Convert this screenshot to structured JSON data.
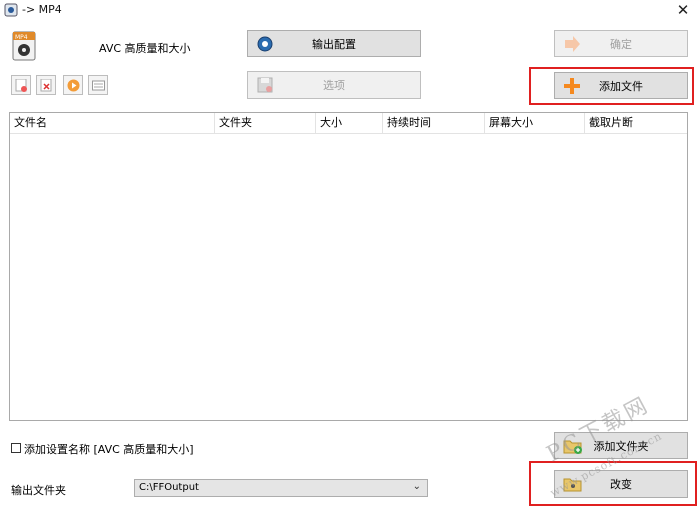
{
  "window": {
    "title": "-> MP4",
    "close_glyph": "✕"
  },
  "format": {
    "label": "AVC 高质量和大小",
    "icon": "mp4-format-icon"
  },
  "toolbar": {
    "output_config_label": "输出配置",
    "options_label": "选项",
    "confirm_label": "确定",
    "add_file_label": "添加文件",
    "small_buttons": [
      "remove-file-icon",
      "clear-list-icon",
      "play-icon",
      "media-info-icon"
    ]
  },
  "list": {
    "columns": [
      "文件名",
      "文件夹",
      "大小",
      "持续时间",
      "屏幕大小",
      "截取片断"
    ],
    "rows": []
  },
  "bottom": {
    "checkbox_label": "添加设置名称 [AVC 高质量和大小]",
    "checkbox_checked": false,
    "output_folder_label": "输出文件夹",
    "output_folder_value": "C:\\FFOutput",
    "add_folder_label": "添加文件夹",
    "change_label": "改变"
  },
  "watermark": {
    "line1": "PC下载网",
    "line2": "www.pcsoft.com.cn"
  },
  "colors": {
    "highlight": "#e02020",
    "add_icon": "#f5891f"
  }
}
